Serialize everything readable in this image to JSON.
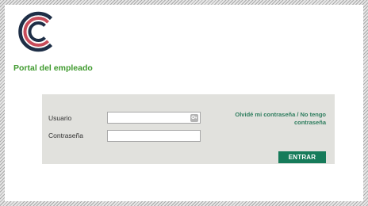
{
  "brand": {
    "logo_icon": "cc-circle-logo-icon",
    "colors": {
      "dark": "#1e2e46",
      "red": "#c84c5a",
      "green_text": "#3f9a2e",
      "button": "#167b5a"
    }
  },
  "header": {
    "title": "Portal del empleado"
  },
  "login": {
    "username_label": "Usuario",
    "username_value": "",
    "username_icon": "key-icon",
    "password_label": "Contraseña",
    "password_value": "",
    "forgot_link": "Olvidé mi contraseña / No tengo contraseña",
    "submit_label": "ENTRAR"
  }
}
